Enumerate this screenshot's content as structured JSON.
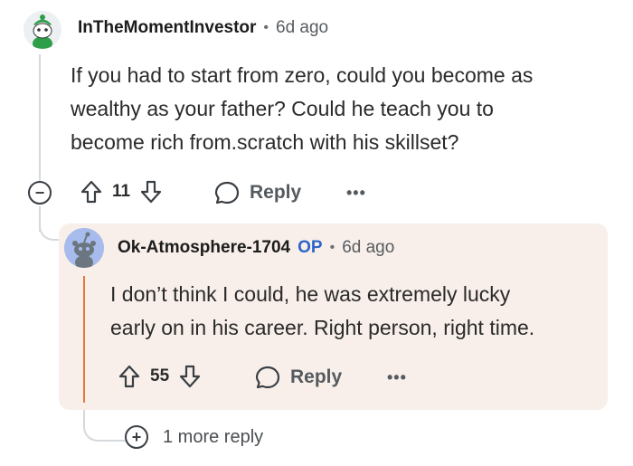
{
  "parent_comment": {
    "username": "InTheMomentInvestor",
    "separator": "•",
    "time": "6d ago",
    "body_lines": [
      "If you had to start from zero, could you become as",
      "wealthy as your father? Could he teach you to",
      "become rich from.scratch with his skillset?"
    ],
    "vote_count": "11",
    "reply_label": "Reply",
    "more_label": "•••",
    "collapse_symbol": "−"
  },
  "reply_comment": {
    "username": "Ok-Atmosphere-1704",
    "op_badge": "OP",
    "separator": "•",
    "time": "6d ago",
    "body_lines": [
      "I don’t think I could, he was extremely lucky",
      "early on in his career. Right person, right time."
    ],
    "vote_count": "55",
    "reply_label": "Reply",
    "more_label": "•••"
  },
  "more_replies": {
    "expand_symbol": "+",
    "label": "1 more reply"
  },
  "colors": {
    "op_accent": "#2e66c8",
    "highlight_bg": "#f8efea",
    "thread_line": "#d5d9dc",
    "op_rule": "#e2793f"
  },
  "icons": [
    "avatar-snoo-green",
    "avatar-snoo-blue",
    "upvote-icon",
    "downvote-icon",
    "comment-bubble-icon",
    "collapse-icon",
    "expand-icon",
    "more-options-icon"
  ]
}
